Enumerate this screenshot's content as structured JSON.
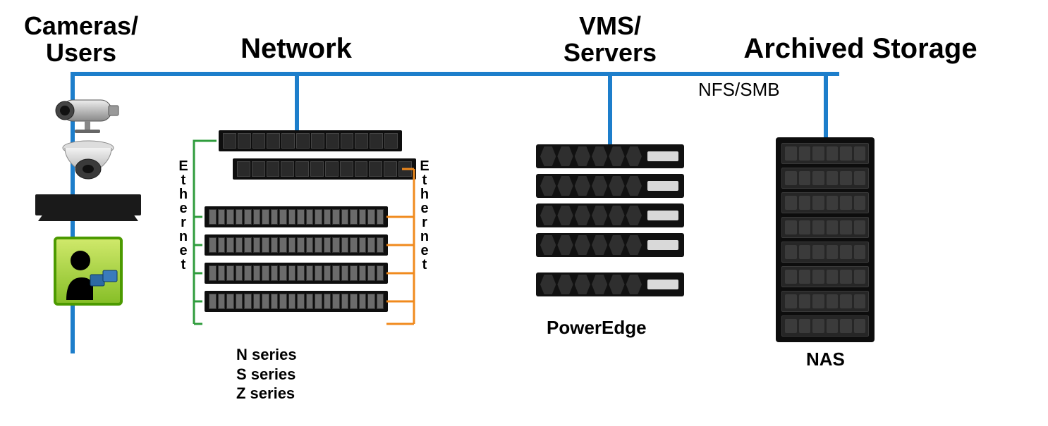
{
  "columns": {
    "cameras": {
      "title": "Cameras/\nUsers"
    },
    "network": {
      "title": "Network",
      "link_label_left": "Ethernet",
      "link_label_right": "Ethernet",
      "series": [
        "N series",
        "S series",
        "Z series"
      ]
    },
    "vms": {
      "title": "VMS/\nServers",
      "product_label": "PowerEdge"
    },
    "storage": {
      "title": "Archived Storage",
      "protocol": "NFS/SMB",
      "product_label": "NAS"
    }
  },
  "colors": {
    "bus": "#1d7ecb",
    "ethernet_left": "#2f9c3c",
    "ethernet_right": "#f08a1d"
  }
}
